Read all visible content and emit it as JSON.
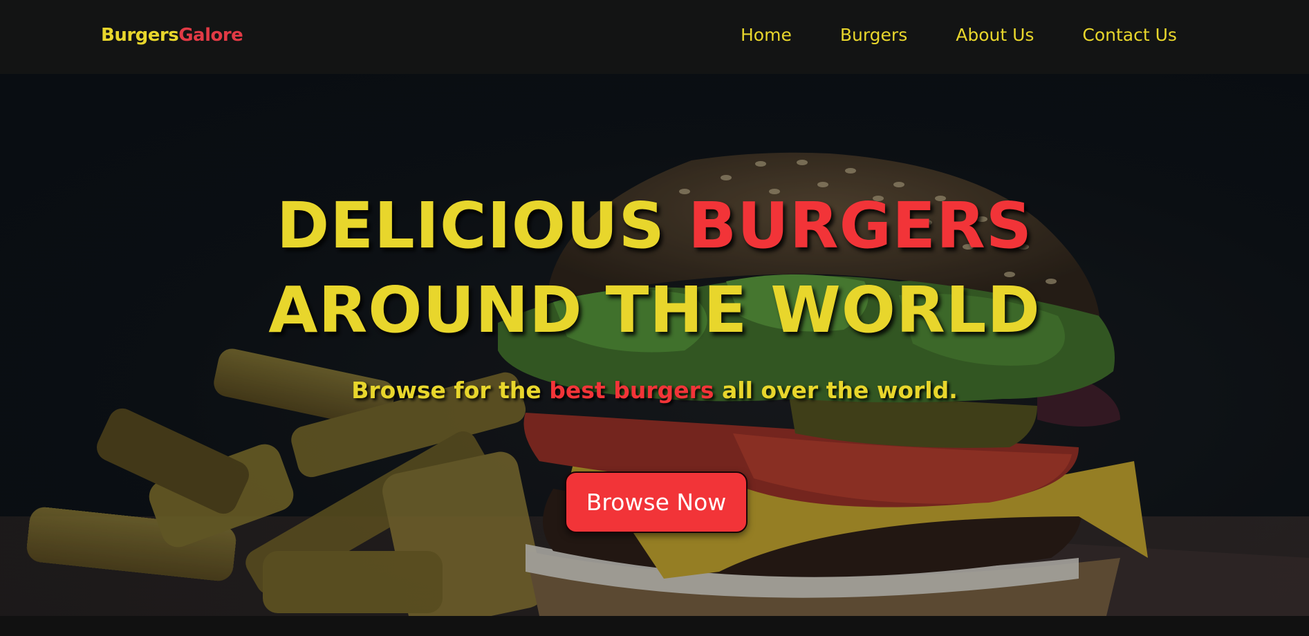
{
  "brand": {
    "part_a": "Burgers",
    "part_b": "Galore"
  },
  "nav": {
    "items": [
      {
        "label": "Home"
      },
      {
        "label": "Burgers"
      },
      {
        "label": "About Us"
      },
      {
        "label": "Contact Us"
      }
    ]
  },
  "hero": {
    "headline_line1": {
      "part_a": "DELICIOUS ",
      "part_b": "BURGERS"
    },
    "headline_line2": "AROUND THE WORLD",
    "subline": {
      "before": "Browse for the ",
      "highlight": "best burgers",
      "after": " all over the world."
    },
    "cta_label": "Browse Now"
  },
  "colors": {
    "accent_yellow": "#e8d62c",
    "accent_red": "#f23438",
    "logo_red": "#e23a45",
    "navbar_bg": "#131414"
  }
}
